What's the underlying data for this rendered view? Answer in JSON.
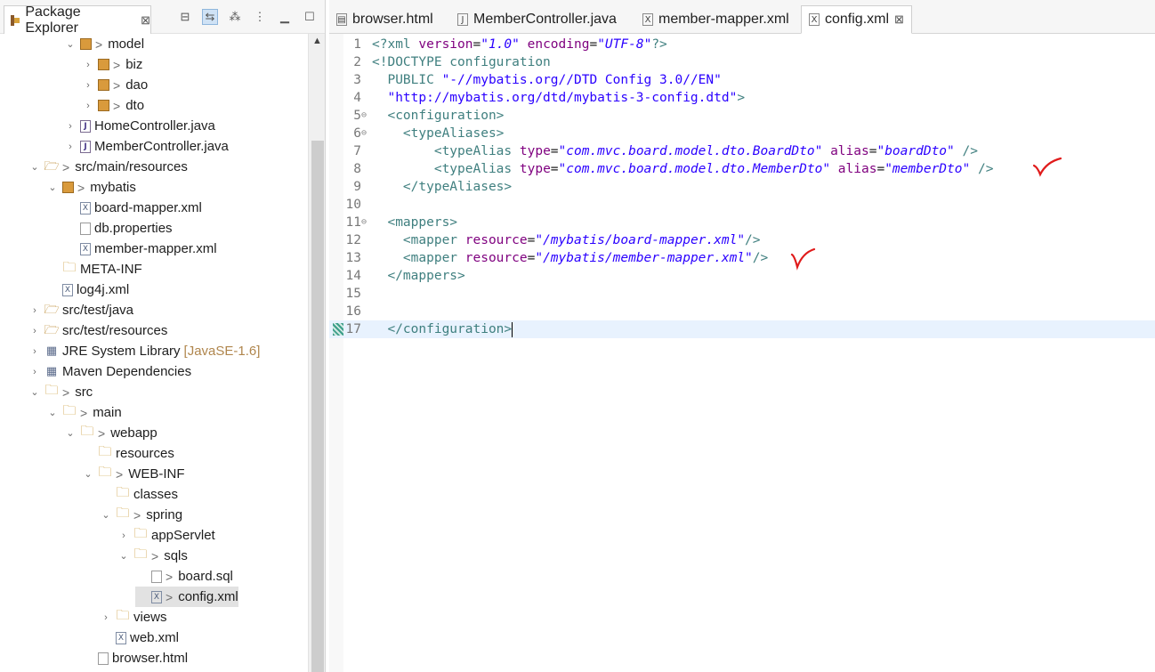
{
  "package_explorer": {
    "title": "Package Explorer",
    "close": "⊠",
    "tools": [
      "collapse-all-icon",
      "link-with-editor-icon",
      "focus-icon",
      "view-menu-icon",
      "minimize-icon",
      "maximize-icon"
    ],
    "items": [
      {
        "indent": 72,
        "twisty": "v",
        "icon": "package-icon",
        "gt": true,
        "label": "model"
      },
      {
        "indent": 92,
        "twisty": ">",
        "icon": "package-icon",
        "gt": true,
        "label": "biz"
      },
      {
        "indent": 92,
        "twisty": ">",
        "icon": "package-icon",
        "gt": true,
        "label": "dao"
      },
      {
        "indent": 92,
        "twisty": ">",
        "icon": "package-icon",
        "gt": true,
        "label": "dto"
      },
      {
        "indent": 72,
        "twisty": ">",
        "icon": "java-file-icon",
        "gt": false,
        "label": "HomeController.java"
      },
      {
        "indent": 72,
        "twisty": ">",
        "icon": "java-file-icon",
        "gt": false,
        "label": "MemberController.java"
      },
      {
        "indent": 32,
        "twisty": "v",
        "icon": "source-folder-icon",
        "gt": true,
        "label": "src/main/resources"
      },
      {
        "indent": 52,
        "twisty": "v",
        "icon": "package-icon",
        "gt": true,
        "label": "mybatis"
      },
      {
        "indent": 72,
        "twisty": "",
        "icon": "xml-file-icon",
        "gt": false,
        "label": "board-mapper.xml"
      },
      {
        "indent": 72,
        "twisty": "",
        "icon": "file-icon",
        "gt": false,
        "label": "db.properties"
      },
      {
        "indent": 72,
        "twisty": "",
        "icon": "xml-file-icon",
        "gt": false,
        "label": "member-mapper.xml"
      },
      {
        "indent": 52,
        "twisty": "",
        "icon": "folder-icon",
        "gt": false,
        "label": "META-INF"
      },
      {
        "indent": 52,
        "twisty": "",
        "icon": "xml-file-icon",
        "gt": false,
        "label": "log4j.xml"
      },
      {
        "indent": 32,
        "twisty": ">",
        "icon": "source-folder-icon",
        "gt": false,
        "label": "src/test/java"
      },
      {
        "indent": 32,
        "twisty": ">",
        "icon": "source-folder-icon",
        "gt": false,
        "label": "src/test/resources"
      },
      {
        "indent": 32,
        "twisty": ">",
        "icon": "library-icon",
        "gt": false,
        "label": "JRE System Library",
        "deco": "[JavaSE-1.6]"
      },
      {
        "indent": 32,
        "twisty": ">",
        "icon": "library-icon",
        "gt": false,
        "label": "Maven Dependencies"
      },
      {
        "indent": 32,
        "twisty": "v",
        "icon": "folder-icon",
        "gt": true,
        "label": "src"
      },
      {
        "indent": 52,
        "twisty": "v",
        "icon": "folder-icon",
        "gt": true,
        "label": "main"
      },
      {
        "indent": 72,
        "twisty": "v",
        "icon": "folder-icon",
        "gt": true,
        "label": "webapp"
      },
      {
        "indent": 92,
        "twisty": "",
        "icon": "folder-icon",
        "gt": false,
        "label": "resources"
      },
      {
        "indent": 92,
        "twisty": "v",
        "icon": "folder-icon",
        "gt": true,
        "label": "WEB-INF"
      },
      {
        "indent": 112,
        "twisty": "",
        "icon": "folder-icon",
        "gt": false,
        "label": "classes"
      },
      {
        "indent": 112,
        "twisty": "v",
        "icon": "folder-icon",
        "gt": true,
        "label": "spring"
      },
      {
        "indent": 132,
        "twisty": ">",
        "icon": "folder-icon",
        "gt": false,
        "label": "appServlet"
      },
      {
        "indent": 132,
        "twisty": "v",
        "icon": "folder-icon",
        "gt": true,
        "label": "sqls"
      },
      {
        "indent": 152,
        "twisty": "",
        "icon": "file-icon",
        "gt": true,
        "label": "board.sql"
      },
      {
        "indent": 152,
        "twisty": "",
        "icon": "xml-file-icon",
        "gt": true,
        "label": "config.xml",
        "selected": true
      },
      {
        "indent": 112,
        "twisty": ">",
        "icon": "folder-icon",
        "gt": false,
        "label": "views"
      },
      {
        "indent": 112,
        "twisty": "",
        "icon": "xml-file-icon",
        "gt": false,
        "label": "web.xml"
      },
      {
        "indent": 92,
        "twisty": "",
        "icon": "file-icon",
        "gt": false,
        "label": "browser.html"
      }
    ]
  },
  "editor": {
    "tabs": [
      {
        "label": "browser.html",
        "icon": "html-file-icon",
        "active": false
      },
      {
        "label": "MemberController.java",
        "icon": "java-file-icon",
        "active": false
      },
      {
        "label": "member-mapper.xml",
        "icon": "xml-file-icon",
        "active": false
      },
      {
        "label": "config.xml",
        "icon": "xml-file-icon",
        "active": true,
        "close": "⊠"
      }
    ],
    "current_line": 17,
    "lines": [
      {
        "n": "1",
        "fold": "",
        "segs": [
          [
            "tg",
            "<?xml "
          ],
          [
            "at",
            "version"
          ],
          [
            "",
            "="
          ],
          [
            "vl",
            "\"1.0\""
          ],
          [
            "at",
            " encoding"
          ],
          [
            "",
            "="
          ],
          [
            "vl",
            "\"UTF-8\""
          ],
          [
            "tg",
            "?>"
          ]
        ]
      },
      {
        "n": "2",
        "fold": "",
        "segs": [
          [
            "tg",
            "<!DOCTYPE configuration"
          ]
        ]
      },
      {
        "n": "3",
        "fold": "",
        "segs": [
          [
            "pl",
            "  PUBLIC "
          ],
          [
            "st",
            "\"-//mybatis.org//DTD Config 3.0//EN\""
          ]
        ]
      },
      {
        "n": "4",
        "fold": "",
        "segs": [
          [
            "st",
            "  \"http://mybatis.org/dtd/mybatis-3-config.dtd\""
          ],
          [
            "tg",
            ">"
          ]
        ]
      },
      {
        "n": "5",
        "fold": "⊖",
        "segs": [
          [
            "tg",
            "  <configuration>"
          ]
        ]
      },
      {
        "n": "6",
        "fold": "⊖",
        "segs": [
          [
            "tg",
            "    <typeAliases>"
          ]
        ]
      },
      {
        "n": "7",
        "fold": "",
        "segs": [
          [
            "tg",
            "        <typeAlias "
          ],
          [
            "at",
            "type"
          ],
          [
            "",
            "="
          ],
          [
            "vl",
            "\"com.mvc.board.model.dto.BoardDto\""
          ],
          [
            "at",
            " alias"
          ],
          [
            "",
            "="
          ],
          [
            "vl",
            "\"boardDto\""
          ],
          [
            "tg",
            " />"
          ]
        ]
      },
      {
        "n": "8",
        "fold": "",
        "segs": [
          [
            "tg",
            "        <typeAlias "
          ],
          [
            "at",
            "type"
          ],
          [
            "",
            "="
          ],
          [
            "vl",
            "\"com.mvc.board.model.dto.MemberDto\""
          ],
          [
            "at",
            " alias"
          ],
          [
            "",
            "="
          ],
          [
            "vl",
            "\"memberDto\""
          ],
          [
            "tg",
            " />"
          ]
        ]
      },
      {
        "n": "9",
        "fold": "",
        "segs": [
          [
            "tg",
            "    </typeAliases>"
          ]
        ]
      },
      {
        "n": "10",
        "fold": "",
        "segs": []
      },
      {
        "n": "11",
        "fold": "⊖",
        "segs": [
          [
            "tg",
            "  <mappers>"
          ]
        ]
      },
      {
        "n": "12",
        "fold": "",
        "segs": [
          [
            "tg",
            "    <mapper "
          ],
          [
            "at",
            "resource"
          ],
          [
            "",
            "="
          ],
          [
            "vl",
            "\"/mybatis/board-mapper.xml\""
          ],
          [
            "tg",
            "/>"
          ]
        ]
      },
      {
        "n": "13",
        "fold": "",
        "segs": [
          [
            "tg",
            "    <mapper "
          ],
          [
            "at",
            "resource"
          ],
          [
            "",
            "="
          ],
          [
            "vl",
            "\"/mybatis/member-mapper.xml\""
          ],
          [
            "tg",
            "/>"
          ]
        ]
      },
      {
        "n": "14",
        "fold": "",
        "segs": [
          [
            "tg",
            "  </mappers>"
          ]
        ]
      },
      {
        "n": "15",
        "fold": "",
        "segs": []
      },
      {
        "n": "16",
        "fold": "",
        "segs": []
      },
      {
        "n": "17",
        "fold": "",
        "segs": [
          [
            "tg",
            "  </configuration>"
          ]
        ]
      }
    ]
  },
  "colors": {
    "tag": "#3f7f7f",
    "attribute": "#7f007f",
    "value": "#2a00ff",
    "checkmark": "#e01b1b",
    "selection": "#e2e2e2",
    "current_line": "#e8f2fe"
  },
  "annotations": [
    "red-checkmark-icon",
    "red-checkmark-icon"
  ]
}
